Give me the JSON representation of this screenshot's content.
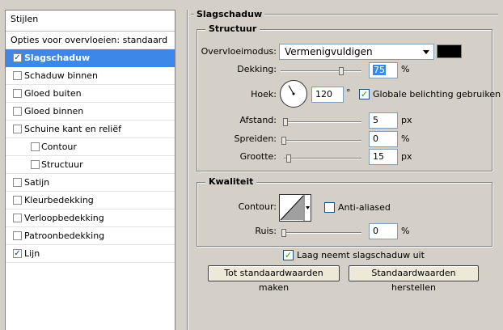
{
  "sidebar": {
    "header": "Stijlen",
    "blend_options": "Opties voor overvloeien: standaard",
    "items": [
      {
        "label": "Slagschaduw",
        "checked": true,
        "selected": true,
        "level": 1
      },
      {
        "label": "Schaduw binnen",
        "checked": false,
        "level": 1
      },
      {
        "label": "Gloed buiten",
        "checked": false,
        "level": 1
      },
      {
        "label": "Gloed binnen",
        "checked": false,
        "level": 1
      },
      {
        "label": "Schuine kant en reliëf",
        "checked": false,
        "level": 1
      },
      {
        "label": "Contour",
        "checked": false,
        "level": 2
      },
      {
        "label": "Structuur",
        "checked": false,
        "level": 2
      },
      {
        "label": "Satijn",
        "checked": false,
        "level": 1
      },
      {
        "label": "Kleurbedekking",
        "checked": false,
        "level": 1
      },
      {
        "label": "Verloopbedekking",
        "checked": false,
        "level": 1
      },
      {
        "label": "Patroonbedekking",
        "checked": false,
        "level": 1
      },
      {
        "label": "Lijn",
        "checked": true,
        "level": 1
      }
    ]
  },
  "panel": {
    "title": "Slagschaduw",
    "structure": {
      "title": "Structuur",
      "blend_mode_label": "Overvloeimodus:",
      "blend_mode_value": "Vermenigvuldigen",
      "shadow_color": "#000000",
      "opacity_label": "Dekking:",
      "opacity_value": "75",
      "opacity_unit": "%",
      "opacity_level": 0.75,
      "angle_label": "Hoek:",
      "angle_value": "120",
      "angle_unit": "°",
      "global_light_label": "Globale belichting gebruiken",
      "global_light_checked": true,
      "distance_label": "Afstand:",
      "distance_value": "5",
      "distance_unit": "px",
      "distance_level": 0.02,
      "spread_label": "Spreiden:",
      "spread_value": "0",
      "spread_unit": "%",
      "spread_level": 0.0,
      "size_label": "Grootte:",
      "size_value": "15",
      "size_unit": "px",
      "size_level": 0.06
    },
    "quality": {
      "title": "Kwaliteit",
      "contour_label": "Contour:",
      "anti_aliased_label": "Anti-aliased",
      "anti_aliased_checked": false,
      "noise_label": "Ruis:",
      "noise_value": "0",
      "noise_unit": "%",
      "noise_level": 0.0
    },
    "knockout_label": "Laag neemt slagschaduw uit",
    "knockout_checked": true,
    "make_default_label": "Tot standaardwaarden maken",
    "reset_default_label": "Standaardwaarden herstellen"
  }
}
